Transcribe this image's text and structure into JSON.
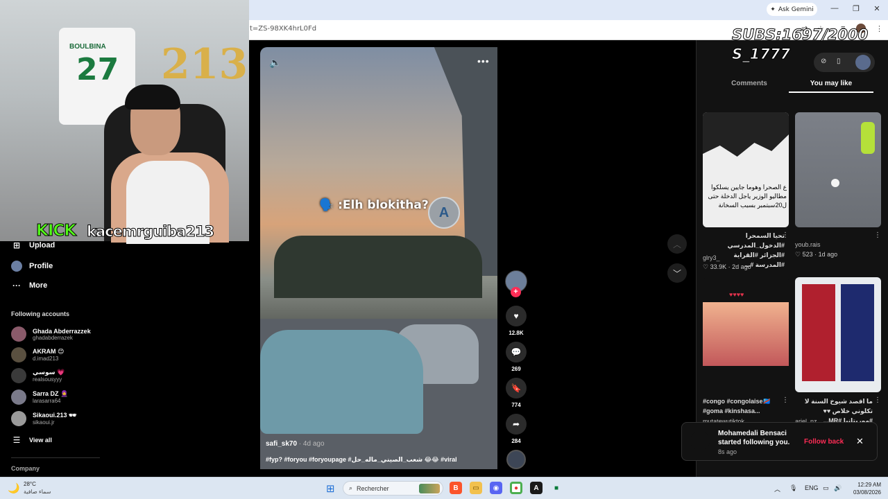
{
  "browser": {
    "url_fragment": "t=ZS-98XK4hrL0Fd",
    "ask_gemini": "Ask Gemini"
  },
  "webcam": {
    "jersey_name": "BOULBINA",
    "jersey_number": "27",
    "balloon_text": "213",
    "kick_brand": "KICK",
    "streamer": "kacemrguiba213"
  },
  "overlay": {
    "subs_line1": "SUBS:1697/2000",
    "subs_line2": "S_1777"
  },
  "sidebar": {
    "upload": "Upload",
    "profile": "Profile",
    "more": "More",
    "following_title": "Following accounts",
    "accounts": [
      {
        "name": "Ghada Abderrazzek",
        "handle": "ghadabderrazek"
      },
      {
        "name": "AKRAM 😊",
        "handle": "d.imad213"
      },
      {
        "name": "سوسي 💗",
        "handle": "realsousyyy"
      },
      {
        "name": "Sarra DZ 🧕",
        "handle": "larasarra64"
      },
      {
        "name": "Sikaoui.213 🕶",
        "handle": "sikaoui.jr"
      }
    ],
    "view_all": "View all",
    "company": "Company"
  },
  "video": {
    "caption": "🗣️ :Elh blokitha?",
    "author": "safi_sk70",
    "time": " · 4d ago",
    "description": "#fyp? #foryou #foryoupage #شعب_الصيني_ماله_حل 😂😂 #viral",
    "likes": "12.8K",
    "comments": "269",
    "saves": "774",
    "shares": "284"
  },
  "panel": {
    "tab_comments": "Comments",
    "tab_like": "You may like",
    "items": [
      {
        "overlay": "ع الصحرا وهوما جايين يسلكوا مطاليو الوزير ياجل الدخلة حتى ل20سبتمبر بسبب السخانة",
        "desc": "تحيا السمحرا #الدخول_المدرسي #الجزائر #القراية #المدرسة #...",
        "user": "glry3_",
        "stats": "♡ 33.9K · 2d ago"
      },
      {
        "desc": "",
        "user": "youb.rais",
        "stats": "♡ 523 · 1d ago"
      },
      {
        "desc": "#congo #congolaise🇨🇩 #goma #kinshasa...",
        "user": "mutatewutiktok"
      },
      {
        "desc": "ما اقصد شيوخ السنة لا تكلوني خلاص ♥♥ #موريتانيا #MR...",
        "user": "ariel_nz"
      }
    ]
  },
  "toast": {
    "name": "Mohamedali Bensaci",
    "message": "started following you.",
    "time": "8s ago",
    "follow_back": "Follow back"
  },
  "taskbar": {
    "temperature": "28°C",
    "weather_desc": "سماء صافية",
    "search_placeholder": "Rechercher",
    "lang": "ENG",
    "time": "12:29 AM",
    "date": "03/08/2026"
  }
}
